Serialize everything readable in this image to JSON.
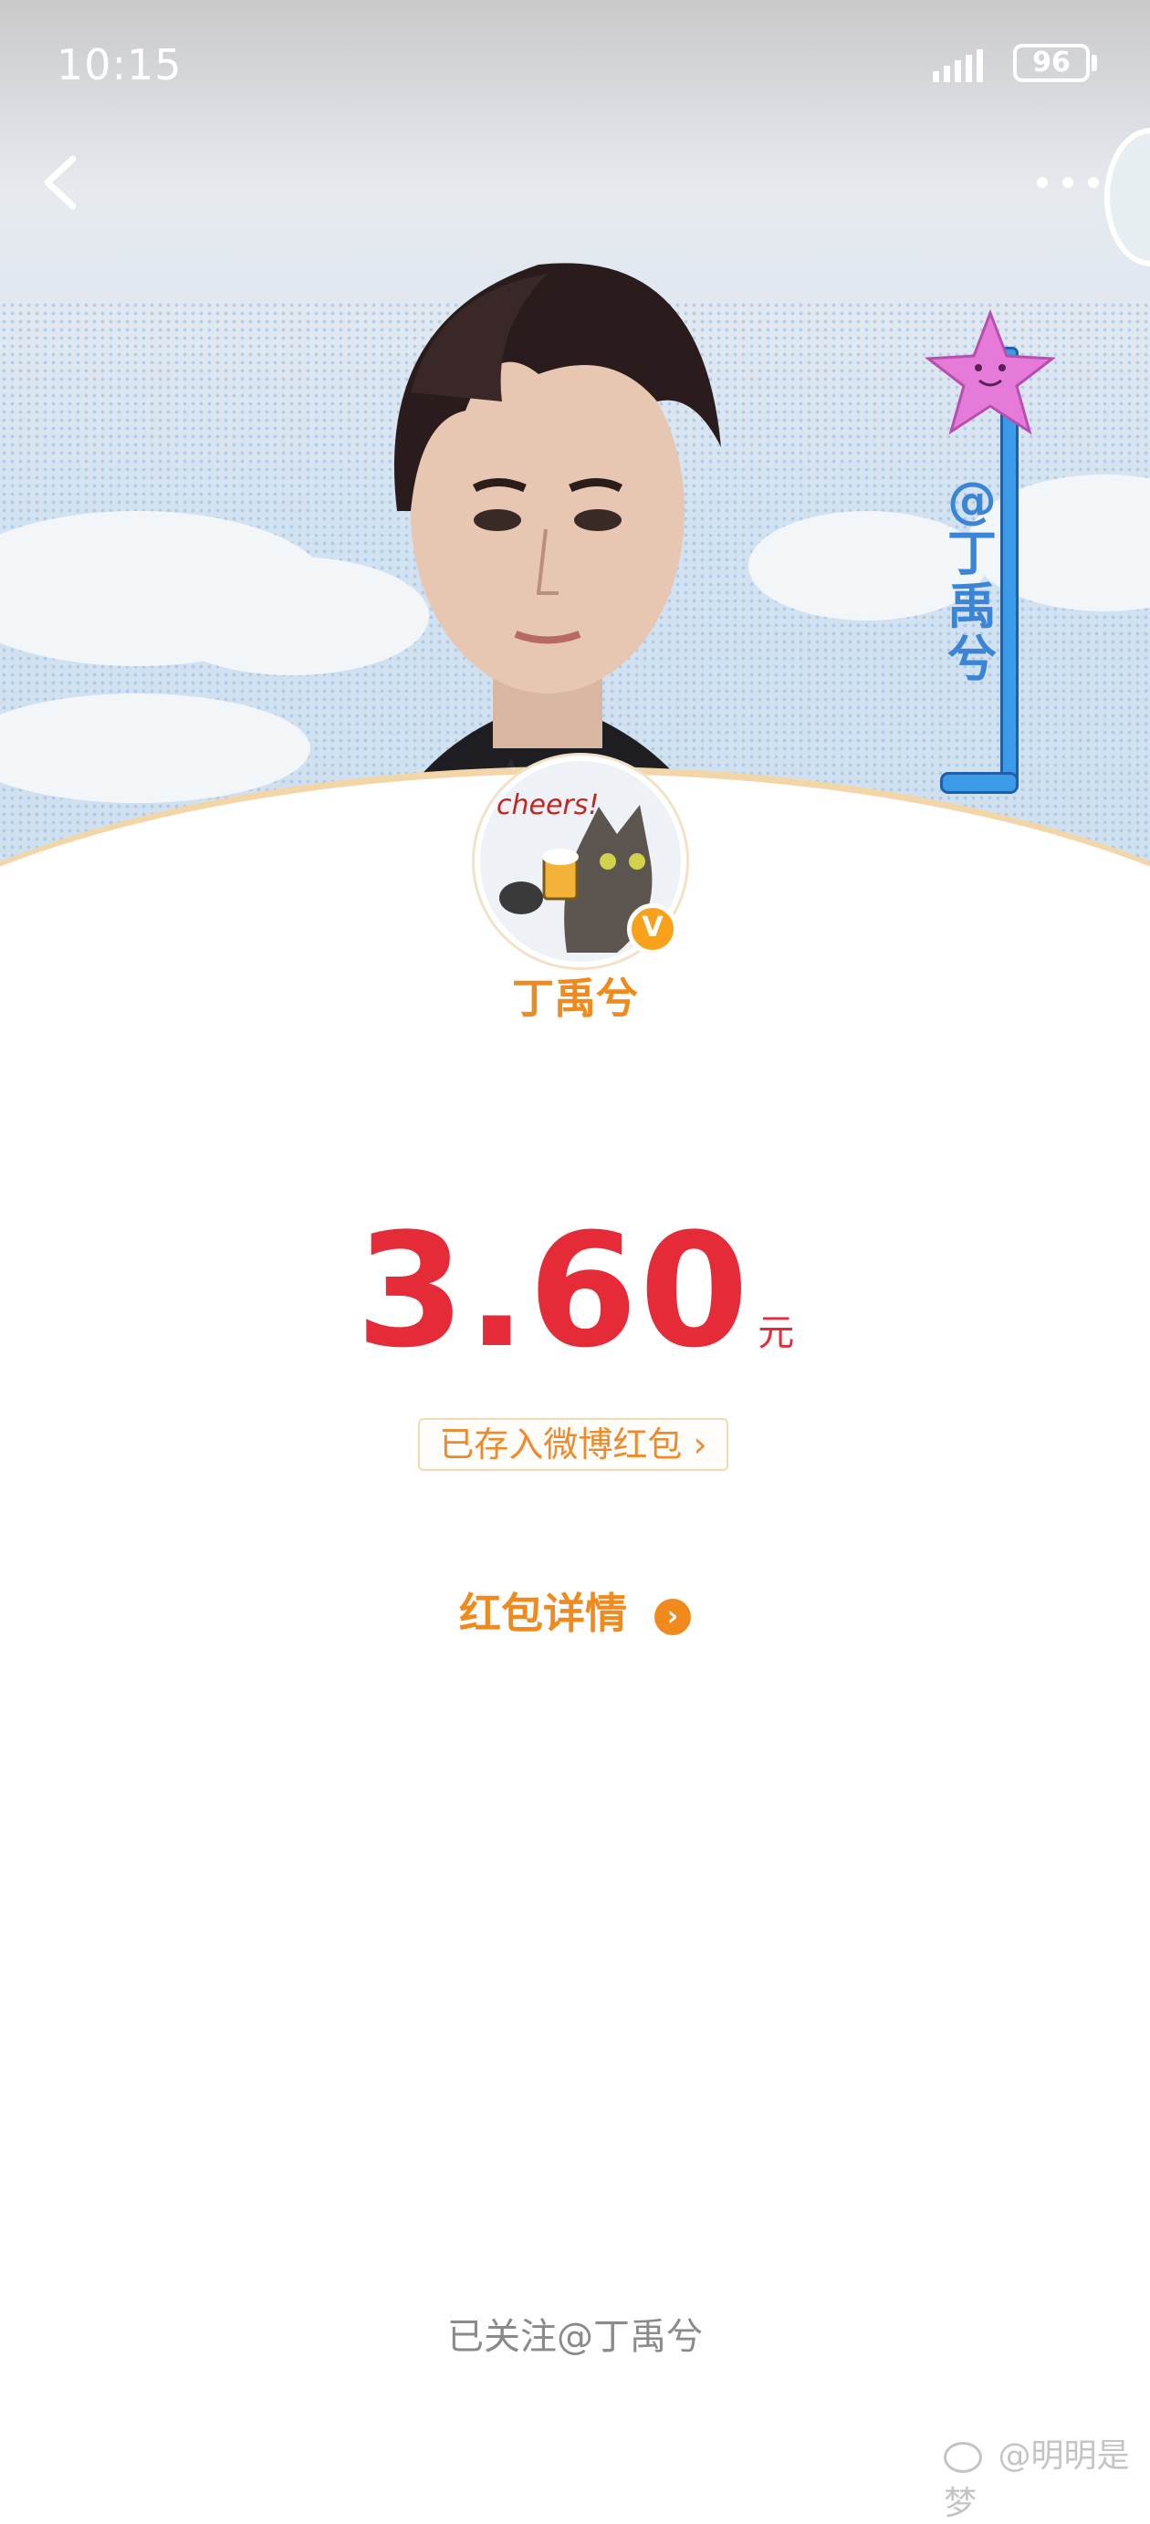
{
  "status_bar": {
    "time": "10:15",
    "battery": "96"
  },
  "header": {
    "side_tag_text": [
      "@",
      "丁",
      "禹",
      "兮"
    ],
    "avatar_text": "cheers!"
  },
  "user": {
    "nickname": "丁禹兮",
    "verified_badge": "V"
  },
  "red_packet": {
    "amount": "3.60",
    "unit": "元",
    "saved_label": "已存入微博红包",
    "saved_chevron": "›",
    "details_label": "红包详情",
    "details_arrow": "›"
  },
  "footer": {
    "followed_text": "已关注@丁禹兮"
  },
  "watermark": {
    "text": "@明明是梦"
  },
  "colors": {
    "accent_orange": "#f08a1c",
    "amount_red": "#e42b37",
    "tag_blue": "#3b84d6"
  }
}
